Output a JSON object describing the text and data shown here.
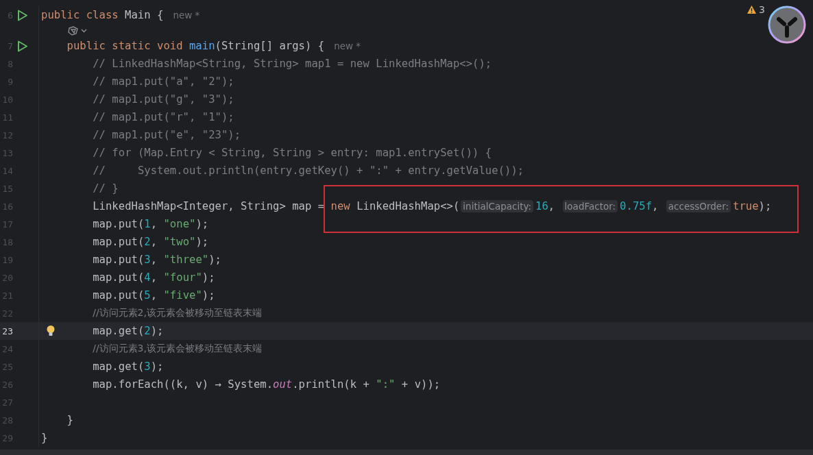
{
  "inspections": {
    "warnings": "3"
  },
  "lines": [
    {
      "kind": "code",
      "number": "6",
      "run_marker": true,
      "bulb": false,
      "current": false,
      "tokens": [
        {
          "kind": "keyword",
          "text": "public class "
        },
        {
          "kind": "plain",
          "text": "Main {"
        },
        {
          "kind": "newhint",
          "text": "new *"
        }
      ],
      "children": [
        {
          "kind": "inlay"
        },
        {
          "kind": "code",
          "number": "7",
          "run_marker": true,
          "bulb": false,
          "current": false,
          "tokens": [
            {
              "kind": "keyword",
              "text": "public static void "
            },
            {
              "kind": "method",
              "text": "main"
            },
            {
              "kind": "plain",
              "text": "(String[] args) {"
            },
            {
              "kind": "newhint",
              "text": "new *"
            }
          ],
          "children": [
            {
              "kind": "code",
              "number": "8",
              "run_marker": false,
              "bulb": false,
              "current": false,
              "tokens": [
                {
                  "kind": "comment",
                  "text": "// LinkedHashMap<String, String> map1 = new LinkedHashMap<>();"
                }
              ]
            },
            {
              "kind": "code",
              "number": "9",
              "run_marker": false,
              "bulb": false,
              "current": false,
              "tokens": [
                {
                  "kind": "comment",
                  "text": "// map1.put(\"a\", \"2\");"
                }
              ]
            },
            {
              "kind": "code",
              "number": "10",
              "run_marker": false,
              "bulb": false,
              "current": false,
              "tokens": [
                {
                  "kind": "comment",
                  "text": "// map1.put(\"g\", \"3\");"
                }
              ]
            },
            {
              "kind": "code",
              "number": "11",
              "run_marker": false,
              "bulb": false,
              "current": false,
              "tokens": [
                {
                  "kind": "comment",
                  "text": "// map1.put(\"r\", \"1\");"
                }
              ]
            },
            {
              "kind": "code",
              "number": "12",
              "run_marker": false,
              "bulb": false,
              "current": false,
              "tokens": [
                {
                  "kind": "comment",
                  "text": "// map1.put(\"e\", \"23\");"
                }
              ]
            },
            {
              "kind": "code",
              "number": "13",
              "run_marker": false,
              "bulb": false,
              "current": false,
              "tokens": [
                {
                  "kind": "comment",
                  "text": "// for (Map.Entry < String, String > entry: map1.entrySet()) {"
                }
              ]
            },
            {
              "kind": "code",
              "number": "14",
              "run_marker": false,
              "bulb": false,
              "current": false,
              "tokens": [
                {
                  "kind": "comment",
                  "text": "//     System.out.println(entry.getKey() + \":\" + entry.getValue());"
                }
              ]
            },
            {
              "kind": "code",
              "number": "15",
              "run_marker": false,
              "bulb": false,
              "current": false,
              "tokens": [
                {
                  "kind": "comment",
                  "text": "// }"
                }
              ]
            },
            {
              "kind": "code",
              "number": "16",
              "run_marker": false,
              "bulb": false,
              "current": false,
              "tokens": [
                {
                  "kind": "plain",
                  "text": "LinkedHashMap<Integer, String> map = "
                },
                {
                  "kind": "keyword",
                  "text": "new "
                },
                {
                  "kind": "plain",
                  "text": "LinkedHashMap<>("
                },
                {
                  "kind": "hint",
                  "text": "initialCapacity:"
                },
                {
                  "kind": "number",
                  "text": "16"
                },
                {
                  "kind": "plain",
                  "text": ", "
                },
                {
                  "kind": "hint",
                  "text": "loadFactor:"
                },
                {
                  "kind": "number",
                  "text": "0.75f"
                },
                {
                  "kind": "plain",
                  "text": ", "
                },
                {
                  "kind": "hint",
                  "text": "accessOrder:"
                },
                {
                  "kind": "keyword",
                  "text": "true"
                },
                {
                  "kind": "plain",
                  "text": ");"
                }
              ]
            },
            {
              "kind": "code",
              "number": "17",
              "run_marker": false,
              "bulb": false,
              "current": false,
              "tokens": [
                {
                  "kind": "plain",
                  "text": "map.put("
                },
                {
                  "kind": "number",
                  "text": "1"
                },
                {
                  "kind": "plain",
                  "text": ", "
                },
                {
                  "kind": "string",
                  "text": "\"one\""
                },
                {
                  "kind": "plain",
                  "text": ");"
                }
              ]
            },
            {
              "kind": "code",
              "number": "18",
              "run_marker": false,
              "bulb": false,
              "current": false,
              "tokens": [
                {
                  "kind": "plain",
                  "text": "map.put("
                },
                {
                  "kind": "number",
                  "text": "2"
                },
                {
                  "kind": "plain",
                  "text": ", "
                },
                {
                  "kind": "string",
                  "text": "\"two\""
                },
                {
                  "kind": "plain",
                  "text": ");"
                }
              ]
            },
            {
              "kind": "code",
              "number": "19",
              "run_marker": false,
              "bulb": false,
              "current": false,
              "tokens": [
                {
                  "kind": "plain",
                  "text": "map.put("
                },
                {
                  "kind": "number",
                  "text": "3"
                },
                {
                  "kind": "plain",
                  "text": ", "
                },
                {
                  "kind": "string",
                  "text": "\"three\""
                },
                {
                  "kind": "plain",
                  "text": ");"
                }
              ]
            },
            {
              "kind": "code",
              "number": "20",
              "run_marker": false,
              "bulb": false,
              "current": false,
              "tokens": [
                {
                  "kind": "plain",
                  "text": "map.put("
                },
                {
                  "kind": "number",
                  "text": "4"
                },
                {
                  "kind": "plain",
                  "text": ", "
                },
                {
                  "kind": "string",
                  "text": "\"four\""
                },
                {
                  "kind": "plain",
                  "text": ");"
                }
              ]
            },
            {
              "kind": "code",
              "number": "21",
              "run_marker": false,
              "bulb": false,
              "current": false,
              "tokens": [
                {
                  "kind": "plain",
                  "text": "map.put("
                },
                {
                  "kind": "number",
                  "text": "5"
                },
                {
                  "kind": "plain",
                  "text": ", "
                },
                {
                  "kind": "string",
                  "text": "\"five\""
                },
                {
                  "kind": "plain",
                  "text": ");"
                }
              ]
            },
            {
              "kind": "code",
              "number": "22",
              "run_marker": false,
              "bulb": false,
              "current": false,
              "tokens": [
                {
                  "kind": "comment",
                  "text": "//访问元素2,该元素会被移动至链表末端"
                }
              ]
            },
            {
              "kind": "code",
              "number": "23",
              "run_marker": false,
              "bulb": true,
              "current": true,
              "tokens": [
                {
                  "kind": "plain",
                  "text": "map.get("
                },
                {
                  "kind": "number",
                  "text": "2"
                },
                {
                  "kind": "plain",
                  "text": ");"
                }
              ]
            },
            {
              "kind": "code",
              "number": "24",
              "run_marker": false,
              "bulb": false,
              "current": false,
              "tokens": [
                {
                  "kind": "comment",
                  "text": "//访问元素3,该元素会被移动至链表末端"
                }
              ]
            },
            {
              "kind": "code",
              "number": "25",
              "run_marker": false,
              "bulb": false,
              "current": false,
              "tokens": [
                {
                  "kind": "plain",
                  "text": "map.get("
                },
                {
                  "kind": "number",
                  "text": "3"
                },
                {
                  "kind": "plain",
                  "text": ");"
                }
              ]
            },
            {
              "kind": "code",
              "number": "26",
              "run_marker": false,
              "bulb": false,
              "current": false,
              "tokens": [
                {
                  "kind": "plain",
                  "text": "map.forEach((k, v) → System."
                },
                {
                  "kind": "field",
                  "text": "out"
                },
                {
                  "kind": "plain",
                  "text": ".println(k + "
                },
                {
                  "kind": "string",
                  "text": "\":\""
                },
                {
                  "kind": "plain",
                  "text": " + v));"
                }
              ]
            },
            {
              "kind": "code",
              "number": "27",
              "run_marker": false,
              "bulb": false,
              "current": false
            }
          ]
        },
        {
          "kind": "code",
          "number": "28",
          "run_marker": false,
          "bulb": false,
          "current": false,
          "tokens": [
            {
              "kind": "plain",
              "text": "}"
            }
          ]
        }
      ]
    },
    {
      "kind": "code",
      "number": "29",
      "run_marker": false,
      "bulb": false,
      "current": false,
      "tokens": [
        {
          "kind": "plain",
          "text": "}"
        }
      ]
    }
  ]
}
